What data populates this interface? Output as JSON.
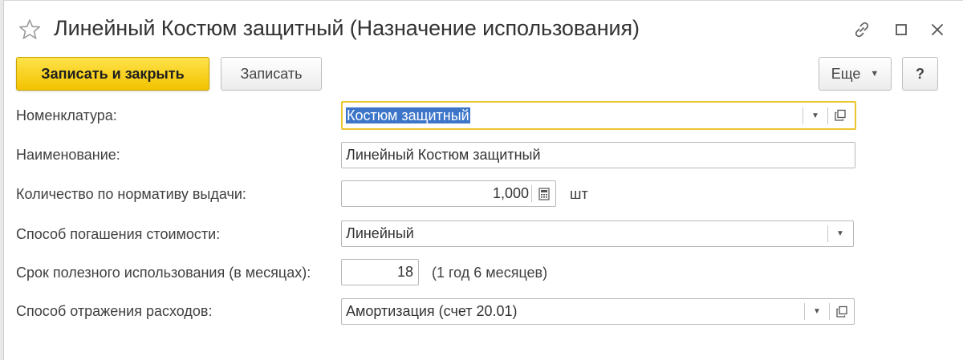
{
  "window": {
    "title": "Линейный Костюм защитный (Назначение использования)"
  },
  "toolbar": {
    "save_close_label": "Записать и закрыть",
    "save_label": "Записать",
    "more_label": "Еще",
    "help_label": "?"
  },
  "form": {
    "nomenclature": {
      "label": "Номенклатура:",
      "value": "Костюм защитный"
    },
    "name": {
      "label": "Наименование:",
      "value": "Линейный Костюм защитный"
    },
    "quantity": {
      "label": "Количество по нормативу выдачи:",
      "value": "1,000",
      "unit": "шт"
    },
    "repayment_method": {
      "label": "Способ погашения стоимости:",
      "value": "Линейный"
    },
    "useful_life": {
      "label": "Срок полезного использования (в месяцах):",
      "value": "18",
      "hint": "(1 год 6 месяцев)"
    },
    "expense_method": {
      "label": "Способ отражения расходов:",
      "value": "Амортизация (счет 20.01)"
    }
  },
  "icons": {
    "favorite": "star-icon",
    "link": "link-icon",
    "maximize": "maximize-icon",
    "close": "close-icon",
    "dropdown": "chevron-down-icon",
    "open": "open-item-icon",
    "calculator": "calculator-icon"
  },
  "colors": {
    "primary_button": "#f5cc17",
    "focus_border": "#ecc630",
    "selection": "#3d76c9",
    "title_text": "#333333"
  }
}
